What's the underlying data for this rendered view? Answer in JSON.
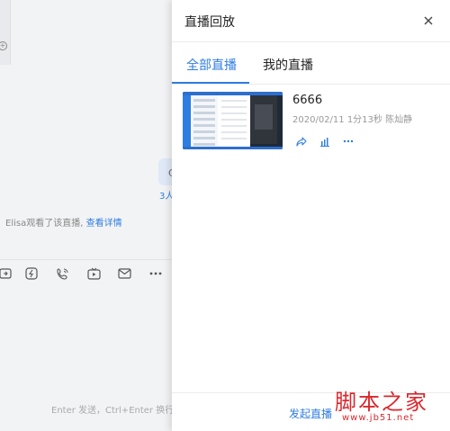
{
  "background": {
    "card_letter": "C",
    "viewer_count": "3人",
    "notice": {
      "text": "Elisa观看了该直播, ",
      "link": "查看详情"
    },
    "input_hint": "Enter 发送，Ctrl+Enter 换行",
    "toolbar_icons": [
      "screen-share-icon",
      "flash-icon",
      "call-icon",
      "live-video-icon",
      "mail-icon",
      "more-icon"
    ]
  },
  "panel": {
    "title": "直播回放",
    "tabs": [
      {
        "label": "全部直播",
        "active": true
      },
      {
        "label": "我的直播",
        "active": false
      }
    ],
    "items": [
      {
        "title": "6666",
        "meta": "2020/02/11  1分13秒  陈灿静",
        "actions": [
          "share-icon",
          "stats-icon",
          "more-icon"
        ]
      }
    ],
    "footer_button": "发起直播"
  },
  "watermark": {
    "brand": "脚本之家",
    "url": "www.jb51.net"
  },
  "colors": {
    "accent": "#2f7de1",
    "watermark": "#d9282d"
  }
}
